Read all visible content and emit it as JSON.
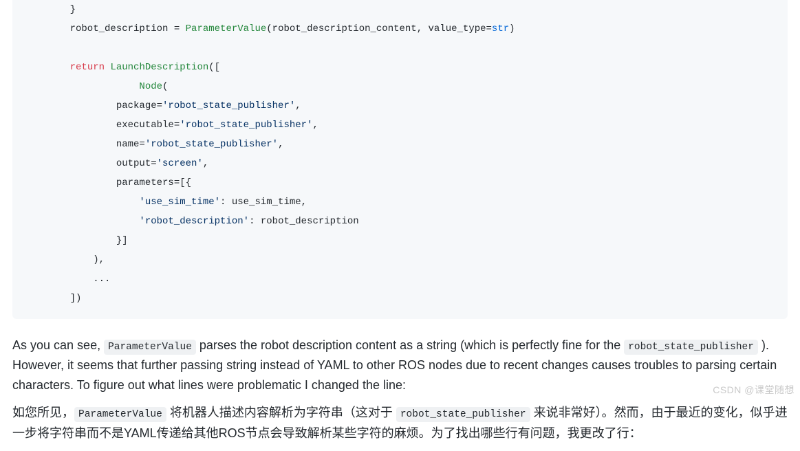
{
  "code": {
    "lines": [
      [
        {
          "c": "",
          "t": "    }"
        }
      ],
      [
        {
          "c": "",
          "t": "    robot_description = "
        },
        {
          "c": "s-fn",
          "t": "ParameterValue"
        },
        {
          "c": "",
          "t": "(robot_description_content, value_type="
        },
        {
          "c": "s-bi",
          "t": "str"
        },
        {
          "c": "",
          "t": ")"
        }
      ],
      [
        {
          "c": "",
          "t": ""
        }
      ],
      [
        {
          "c": "",
          "t": "    "
        },
        {
          "c": "s-kw",
          "t": "return"
        },
        {
          "c": "",
          "t": " "
        },
        {
          "c": "s-fn",
          "t": "LaunchDescription"
        },
        {
          "c": "",
          "t": "(["
        }
      ],
      [
        {
          "c": "",
          "t": "                "
        },
        {
          "c": "s-fn",
          "t": "Node"
        },
        {
          "c": "",
          "t": "("
        }
      ],
      [
        {
          "c": "",
          "t": "            package="
        },
        {
          "c": "s-str",
          "t": "'robot_state_publisher'"
        },
        {
          "c": "",
          "t": ","
        }
      ],
      [
        {
          "c": "",
          "t": "            executable="
        },
        {
          "c": "s-str",
          "t": "'robot_state_publisher'"
        },
        {
          "c": "",
          "t": ","
        }
      ],
      [
        {
          "c": "",
          "t": "            name="
        },
        {
          "c": "s-str",
          "t": "'robot_state_publisher'"
        },
        {
          "c": "",
          "t": ","
        }
      ],
      [
        {
          "c": "",
          "t": "            output="
        },
        {
          "c": "s-str",
          "t": "'screen'"
        },
        {
          "c": "",
          "t": ","
        }
      ],
      [
        {
          "c": "",
          "t": "            parameters=[{"
        }
      ],
      [
        {
          "c": "",
          "t": "                "
        },
        {
          "c": "s-str",
          "t": "'use_sim_time'"
        },
        {
          "c": "",
          "t": ": use_sim_time,"
        }
      ],
      [
        {
          "c": "",
          "t": "                "
        },
        {
          "c": "s-str",
          "t": "'robot_description'"
        },
        {
          "c": "",
          "t": ": robot_description"
        }
      ],
      [
        {
          "c": "",
          "t": "            }]"
        }
      ],
      [
        {
          "c": "",
          "t": "        ),"
        }
      ],
      [
        {
          "c": "",
          "t": "        ..."
        }
      ],
      [
        {
          "c": "",
          "t": "    ])"
        }
      ]
    ]
  },
  "prose": {
    "en_pre": "As you can see, ",
    "en_code1": "ParameterValue",
    "en_mid": " parses the robot description content as a string (which is perfectly fine for the ",
    "en_code2": "robot_state_publisher",
    "en_post": " ). However, it seems that further passing string instead of YAML to other ROS nodes due to recent changes causes troubles to parsing certain characters. To figure out what lines were problematic I changed the line:",
    "cn_pre": "如您所见，",
    "cn_code1": "ParameterValue",
    "cn_mid1": " 将机器人描述内容解析为字符串（这对于 ",
    "cn_code2": "robot_state_publisher",
    "cn_post": " 来说非常好）。然而，由于最近的变化，似乎进一步将字符串而不是YAML传递给其他ROS节点会导致解析某些字符的麻烦。为了找出哪些行有问题，我更改了行："
  },
  "watermark": "CSDN @课堂随想"
}
